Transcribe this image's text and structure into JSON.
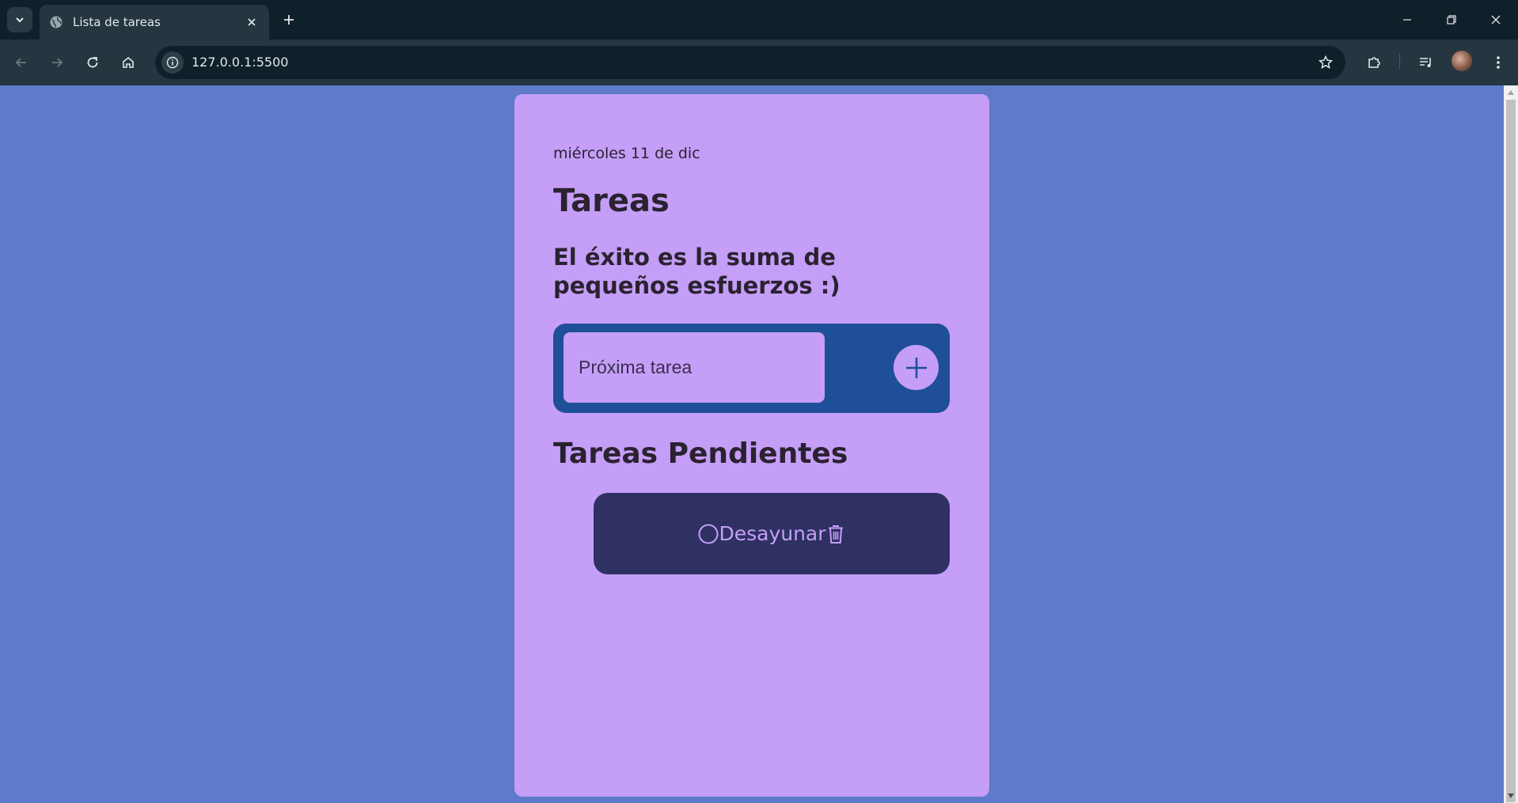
{
  "browser": {
    "tab_title": "Lista de tareas",
    "url": "127.0.0.1:5500"
  },
  "page": {
    "date": "miércoles 11 de dic",
    "title": "Tareas",
    "motto": "El éxito es la suma de pequeños esfuerzos :)",
    "input_placeholder": "Próxima tarea",
    "pending_heading": "Tareas Pendientes",
    "tasks": [
      {
        "label": "Desayunar",
        "done": false
      }
    ]
  },
  "colors": {
    "background": "#5e7bc9",
    "card": "#c59ef7",
    "form": "#1f4f98",
    "task": "#2e3162"
  },
  "icons": {
    "tab_search": "chevron-down-icon",
    "favicon": "globe-icon",
    "tab_close": "close-icon",
    "new_tab": "plus-icon",
    "add": "plus-icon",
    "check": "circle-icon",
    "delete": "trash-icon"
  }
}
